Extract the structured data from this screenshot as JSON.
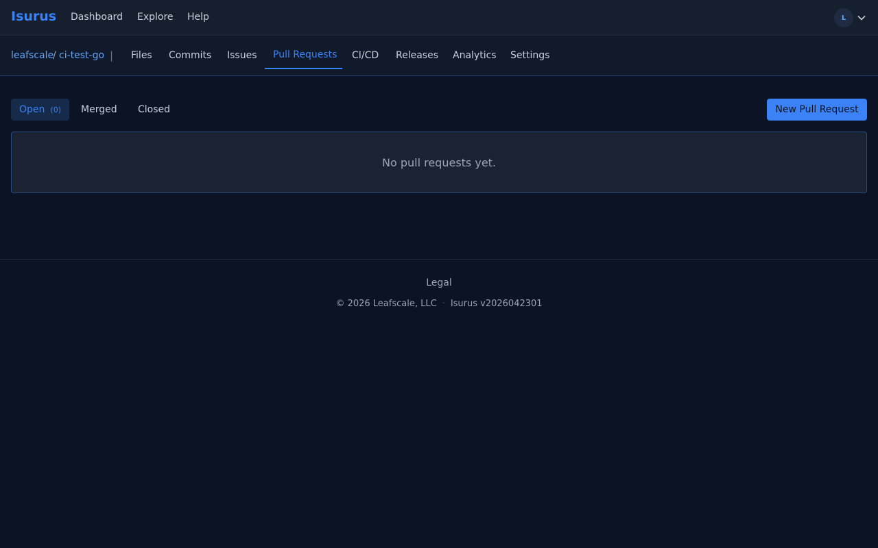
{
  "app": {
    "brand": "Isurus",
    "nav": [
      "Dashboard",
      "Explore",
      "Help"
    ],
    "avatar_letter": "L"
  },
  "repo": {
    "owner": "leafscale",
    "separator": "/",
    "name": "ci-test-go",
    "tabs": [
      "Files",
      "Commits",
      "Issues",
      "Pull Requests",
      "CI/CD",
      "Releases",
      "Analytics",
      "Settings"
    ],
    "active_tab": "Pull Requests"
  },
  "pulls": {
    "filters": [
      {
        "label": "Open",
        "count": "(0)"
      },
      {
        "label": "Merged"
      },
      {
        "label": "Closed"
      }
    ],
    "new_button": "New Pull Request",
    "empty_message": "No pull requests yet."
  },
  "footer": {
    "legal": "Legal",
    "copyright": "© 2026 Leafscale, LLC",
    "dot": "·",
    "version": "Isurus v2026042301"
  },
  "colors": {
    "accent": "#3b82f6",
    "background": "#0b1325",
    "topbar": "#161f2d"
  }
}
